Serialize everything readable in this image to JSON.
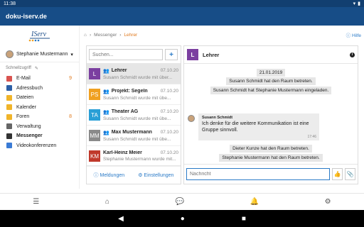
{
  "status": {
    "time": "11:38"
  },
  "appbar": {
    "title": "doku-iserv.de"
  },
  "sidebar": {
    "logo": "IServ",
    "user": "Stephanie Mustermann",
    "quick": "Schnellzugriff",
    "items": [
      {
        "label": "E-Mail",
        "count": "9",
        "color": "#d9534f"
      },
      {
        "label": "Adressbuch",
        "count": "",
        "color": "#2d5fa6"
      },
      {
        "label": "Dateien",
        "count": "",
        "color": "#f0b429"
      },
      {
        "label": "Kalender",
        "count": "",
        "color": "#f0b429"
      },
      {
        "label": "Foren",
        "count": "8",
        "color": "#f0b429"
      },
      {
        "label": "Verwaltung",
        "count": "",
        "color": "#666666"
      },
      {
        "label": "Messenger",
        "count": "",
        "color": "#333333"
      },
      {
        "label": "Videokonferenzen",
        "count": "",
        "color": "#3a7bd5"
      }
    ]
  },
  "breadcrumb": {
    "parent": "Messenger",
    "current": "Lehrer",
    "help": "Hilfe"
  },
  "list": {
    "search_placeholder": "Suchen...",
    "add": "+",
    "conversations": [
      {
        "initials": "L",
        "name": "Lehrer",
        "date": "07.10.20",
        "preview": "Susann Schmidt wurde mit über...",
        "color": "#7b3fa0",
        "group": true
      },
      {
        "initials": "PS",
        "name": "Projekt: Segeln",
        "date": "07.10.20",
        "preview": "Susann Schmidt wurde mit übe...",
        "color": "#f0a020",
        "group": true
      },
      {
        "initials": "TA",
        "name": "Theater AG",
        "date": "07.10.20",
        "preview": "Susann Schmidt wurde mit übe...",
        "color": "#2a9fd6",
        "group": true
      },
      {
        "initials": "MM",
        "name": "Max Mustermann",
        "date": "07.10.20",
        "preview": "Susann Schmidt wurde mit übe...",
        "color": "#8a8a8a",
        "group": true
      },
      {
        "initials": "KM",
        "name": "Karl-Heinz Meier",
        "date": "07.10.20",
        "preview": "Stephanie Mustermann wurde mit...",
        "color": "#c0392b",
        "group": false
      }
    ],
    "footer": {
      "mentions": "Meldungen",
      "settings": "Einstellungen"
    }
  },
  "chat": {
    "title": "Lehrer",
    "initial": "L",
    "date": "21.01.2019",
    "events": [
      "Susann Schmidt hat den Raum betreten.",
      "Susann Schmidt hat Stephanie Mustermann eingeladen.",
      "Dieter Kunze hat den Raum betreten.",
      "Stephanie Mustermann hat den Raum betreten."
    ],
    "message": {
      "author": "Susann Schmidt",
      "text": "Ich denke für die weitere Kommunikation ist eine Gruppe sinnvoll.",
      "time": "17:46"
    },
    "input_placeholder": "Nachricht"
  }
}
